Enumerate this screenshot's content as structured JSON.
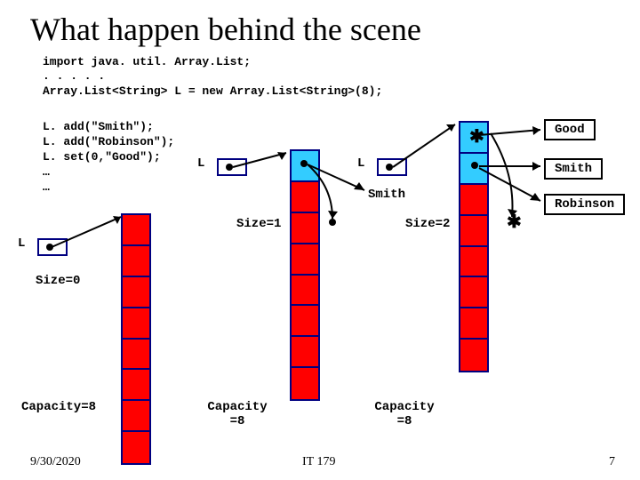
{
  "title": "What happen behind the scene",
  "code": {
    "block1": "import java. util. Array.List;\n. . . . .\nArray.List<String> L = new Array.List<String>(8);",
    "block2": "L. add(\"Smith\");\nL. add(\"Robinson\");\nL. set(0,\"Good\");\n…\n…"
  },
  "diagrams": [
    {
      "L": "L",
      "size": "Size=0",
      "capacity": "Capacity=8"
    },
    {
      "L": "L",
      "size": "Size=1",
      "capacity": "Capacity\n=8"
    },
    {
      "L": "L",
      "size": "Size=2",
      "capacity": "Capacity\n=8"
    }
  ],
  "names": {
    "good": "Good",
    "smith": "Smith",
    "robinson": "Robinson",
    "smith2": "Smith"
  },
  "footer": {
    "date": "9/30/2020",
    "course": "IT 179",
    "page": "7"
  }
}
